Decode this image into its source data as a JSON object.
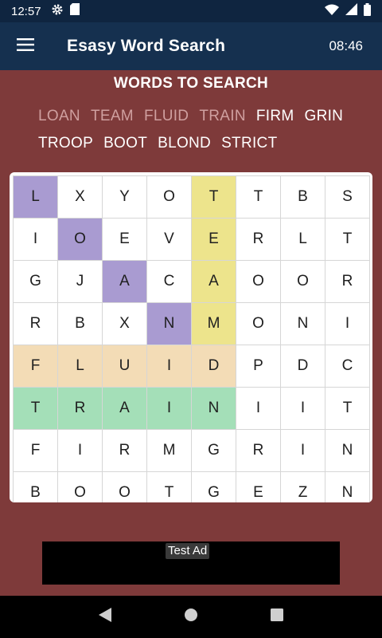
{
  "status_bar": {
    "time": "12:57",
    "icons": [
      "gear-icon",
      "sd-card-icon",
      "wifi-icon",
      "signal-icon",
      "battery-icon"
    ]
  },
  "app_bar": {
    "menu_icon": "hamburger-menu-icon",
    "title": "Esasy Word Search",
    "timer": "08:46"
  },
  "words_header": "WORDS TO SEARCH",
  "words": [
    {
      "text": "LOAN",
      "found": true
    },
    {
      "text": "TEAM",
      "found": true
    },
    {
      "text": "FLUID",
      "found": true
    },
    {
      "text": "TRAIN",
      "found": true
    },
    {
      "text": "FIRM",
      "found": false
    },
    {
      "text": "GRIN",
      "found": false
    },
    {
      "text": "TROOP",
      "found": false
    },
    {
      "text": "BOOT",
      "found": false
    },
    {
      "text": "BLOND",
      "found": false
    },
    {
      "text": "STRICT",
      "found": false
    }
  ],
  "grid": [
    [
      "L",
      "X",
      "Y",
      "O",
      "T",
      "T",
      "B",
      "S"
    ],
    [
      "I",
      "O",
      "E",
      "V",
      "E",
      "R",
      "L",
      "T"
    ],
    [
      "G",
      "J",
      "A",
      "C",
      "A",
      "O",
      "O",
      "R"
    ],
    [
      "R",
      "B",
      "X",
      "N",
      "M",
      "O",
      "N",
      "I"
    ],
    [
      "F",
      "L",
      "U",
      "I",
      "D",
      "P",
      "D",
      "C"
    ],
    [
      "T",
      "R",
      "A",
      "I",
      "N",
      "I",
      "I",
      "T"
    ],
    [
      "F",
      "I",
      "R",
      "M",
      "G",
      "R",
      "I",
      "N"
    ],
    [
      "B",
      "O",
      "O",
      "T",
      "G",
      "E",
      "Z",
      "N"
    ]
  ],
  "highlights": {
    "LOAN": {
      "color": "#a99bd1",
      "cells": [
        [
          0,
          0
        ],
        [
          1,
          1
        ],
        [
          2,
          2
        ],
        [
          3,
          3
        ]
      ]
    },
    "TEAM": {
      "color": "#ede48c",
      "cells": [
        [
          0,
          4
        ],
        [
          1,
          4
        ],
        [
          2,
          4
        ],
        [
          3,
          4
        ]
      ]
    },
    "FLUID": {
      "color": "#f3dcb6",
      "cells": [
        [
          4,
          0
        ],
        [
          4,
          1
        ],
        [
          4,
          2
        ],
        [
          4,
          3
        ],
        [
          4,
          4
        ]
      ]
    },
    "TRAIN": {
      "color": "#a4dfb8",
      "cells": [
        [
          5,
          0
        ],
        [
          5,
          1
        ],
        [
          5,
          2
        ],
        [
          5,
          3
        ],
        [
          5,
          4
        ]
      ]
    }
  },
  "ad": {
    "label": "Test Ad"
  },
  "nav_bar": {
    "buttons": [
      "back-triangle-icon",
      "home-circle-icon",
      "recents-square-icon"
    ]
  }
}
